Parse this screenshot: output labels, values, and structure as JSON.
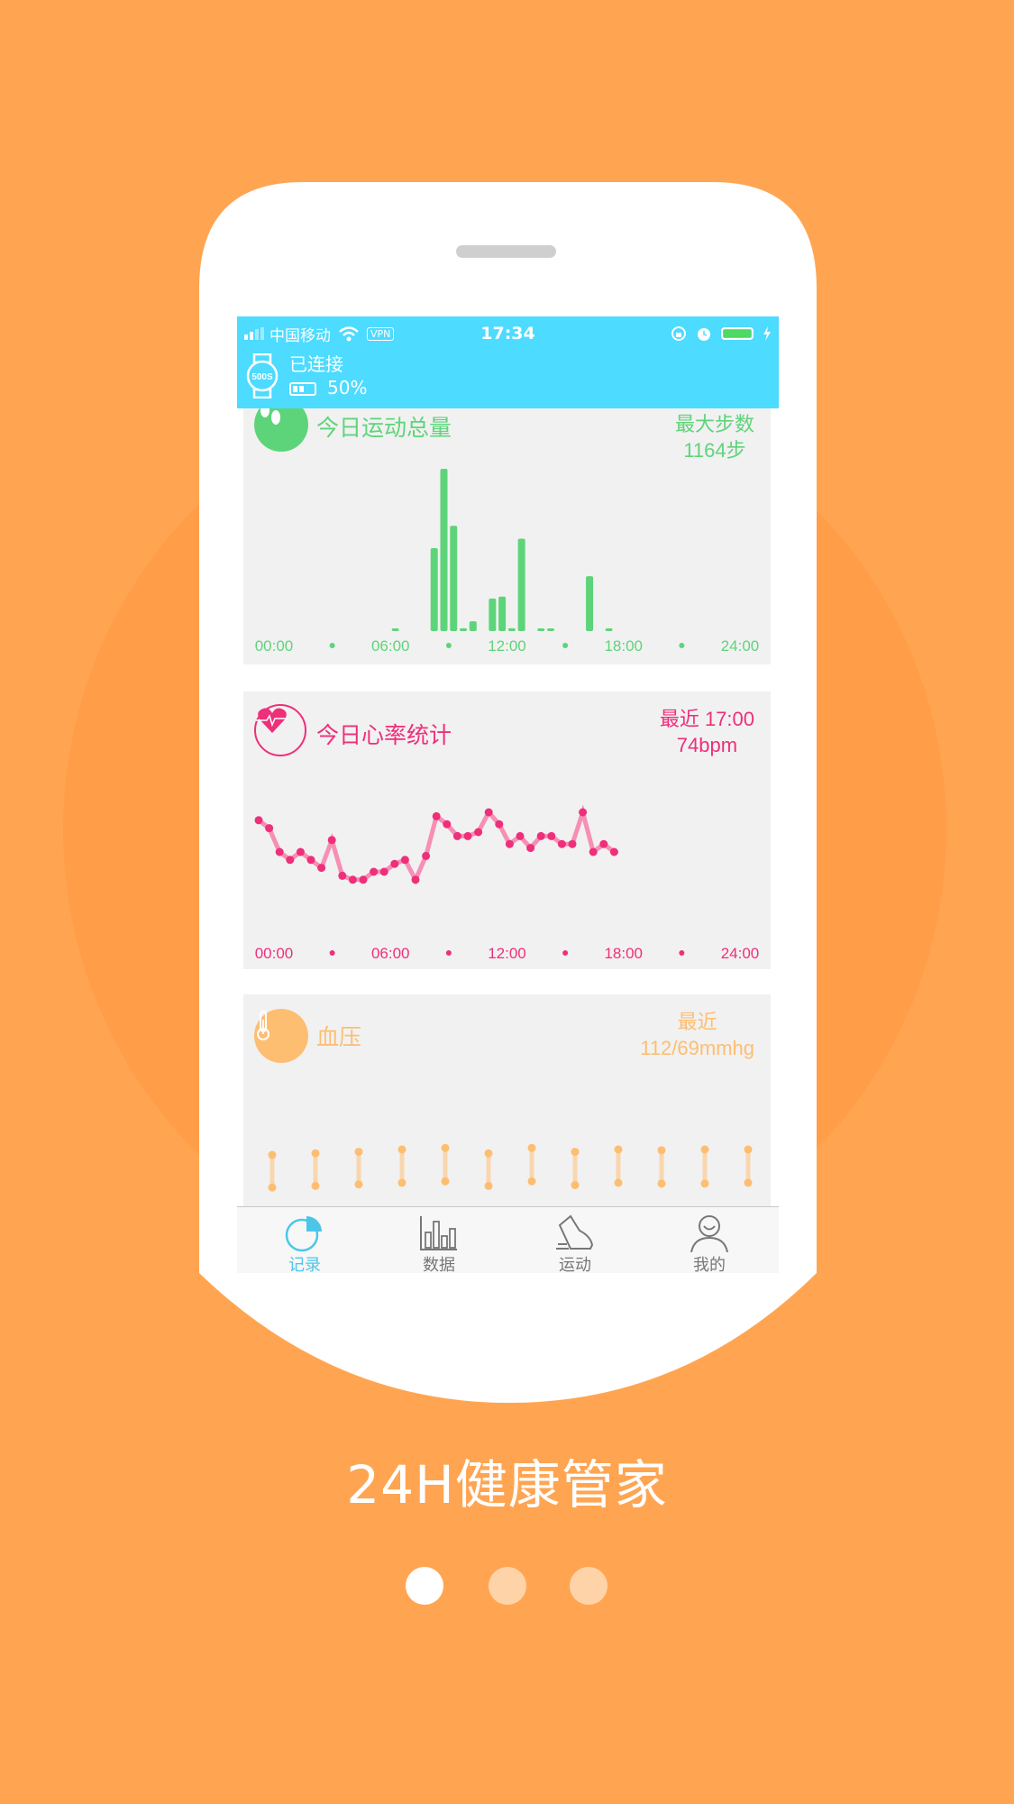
{
  "status_bar": {
    "carrier": "中国移动",
    "vpn": "VPN",
    "time": "17:34"
  },
  "device": {
    "model": "500S",
    "status": "已连接",
    "battery": "50%",
    "battery_level": 0.5
  },
  "steps_card": {
    "title": "今日运动总量",
    "right_label": "最大步数",
    "right_value": "1164步",
    "color": "#5ED47A"
  },
  "heart_card": {
    "title": "今日心率统计",
    "right_label": "最近 17:00",
    "right_value": "74bpm",
    "color": "#EE2F7A"
  },
  "bp_card": {
    "title": "血压",
    "right_label": "最近",
    "right_value": "112/69mmhg",
    "color": "#FDBE72"
  },
  "chart_data": [
    {
      "type": "bar",
      "title": "今日运动总量",
      "x_unit": "hour",
      "x_ticks": [
        "00:00",
        "06:00",
        "12:00",
        "18:00",
        "24:00"
      ],
      "xlim": [
        0,
        24
      ],
      "ylim": [
        0,
        1164
      ],
      "x": [
        6.0,
        8.0,
        8.5,
        9.0,
        9.5,
        10.0,
        11.0,
        11.5,
        12.0,
        12.5,
        13.5,
        14.0,
        16.0,
        17.0
      ],
      "values": [
        15,
        595,
        1164,
        755,
        20,
        70,
        234,
        247,
        20,
        663,
        10,
        10,
        394,
        15
      ]
    },
    {
      "type": "line",
      "title": "今日心率统计",
      "x_ticks": [
        "00:00",
        "06:00",
        "12:00",
        "18:00",
        "24:00"
      ],
      "ylim": [
        50,
        100
      ],
      "values": [
        82,
        80,
        74,
        72,
        74,
        72,
        70,
        77,
        68,
        67,
        67,
        69,
        69,
        71,
        72,
        67,
        73,
        83,
        81,
        78,
        78,
        79,
        84,
        81,
        76,
        78,
        75,
        78,
        78,
        76,
        76,
        84,
        74,
        76,
        74
      ]
    },
    {
      "type": "range",
      "title": "血压",
      "unit": "mmHg",
      "systolic": [
        105,
        107,
        109,
        112,
        114,
        107,
        114,
        109,
        112,
        111,
        112,
        112
      ],
      "diastolic": [
        63,
        65,
        67,
        69,
        71,
        65,
        71,
        66,
        69,
        68,
        68,
        69
      ]
    }
  ],
  "tabs": [
    {
      "label": "记录",
      "icon": "pie-chart-icon",
      "active": true
    },
    {
      "label": "数据",
      "icon": "bar-chart-icon",
      "active": false
    },
    {
      "label": "运动",
      "icon": "shoe-icon",
      "active": false
    },
    {
      "label": "我的",
      "icon": "user-icon",
      "active": false
    }
  ],
  "slogan": "24H健康管家",
  "pager": {
    "count": 3,
    "current": 0
  }
}
